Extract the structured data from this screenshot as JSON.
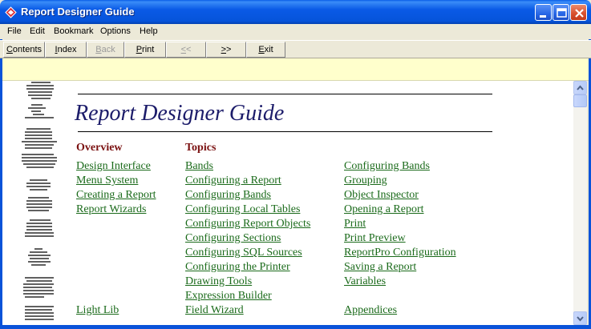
{
  "window": {
    "title": "Report Designer Guide"
  },
  "menu": [
    "File",
    "Edit",
    "Bookmark",
    "Options",
    "Help"
  ],
  "toolbar": [
    {
      "label": "Contents",
      "underline": "C",
      "rest": "ontents",
      "enabled": true
    },
    {
      "label": "Index",
      "underline": "I",
      "rest": "ndex",
      "enabled": true
    },
    {
      "label": "Back",
      "underline": "B",
      "rest": "ack",
      "enabled": false
    },
    {
      "label": "Print",
      "underline": "P",
      "rest": "rint",
      "enabled": true
    },
    {
      "label": "<<",
      "underline": "<",
      "rest": "<",
      "enabled": false
    },
    {
      "label": ">>",
      "underline": ">",
      "rest": ">",
      "enabled": true
    },
    {
      "label": "Exit",
      "underline": "E",
      "rest": "xit",
      "enabled": true
    }
  ],
  "page": {
    "title": "Report Designer Guide",
    "overview_heading": "Overview",
    "topics_heading": "Topics",
    "overview_links": [
      "Design Interface",
      "Menu System",
      "Creating a Report",
      "Report Wizards"
    ],
    "topics_col1": [
      "Bands",
      "Configuring a Report",
      "Configuring Bands",
      "Configuring Local Tables",
      "Configuring Report Objects",
      "Configuring Sections",
      "Configuring SQL Sources",
      "Configuring the Printer",
      "Drawing Tools",
      "Expression Builder",
      "Field Wizard"
    ],
    "topics_col2": [
      "Configuring Bands",
      "Grouping",
      "Object Inspector",
      "Opening a Report",
      "Print",
      "Print Preview",
      "ReportPro Configuration",
      "Saving a Report",
      "Variables"
    ],
    "bottom_link": "Light Lib",
    "appendices_link": "Appendices"
  },
  "colors": {
    "title_text": "#1c1c6a",
    "heading": "#7a1010",
    "link": "#1a6a1a",
    "strip": "#ffffcc"
  }
}
